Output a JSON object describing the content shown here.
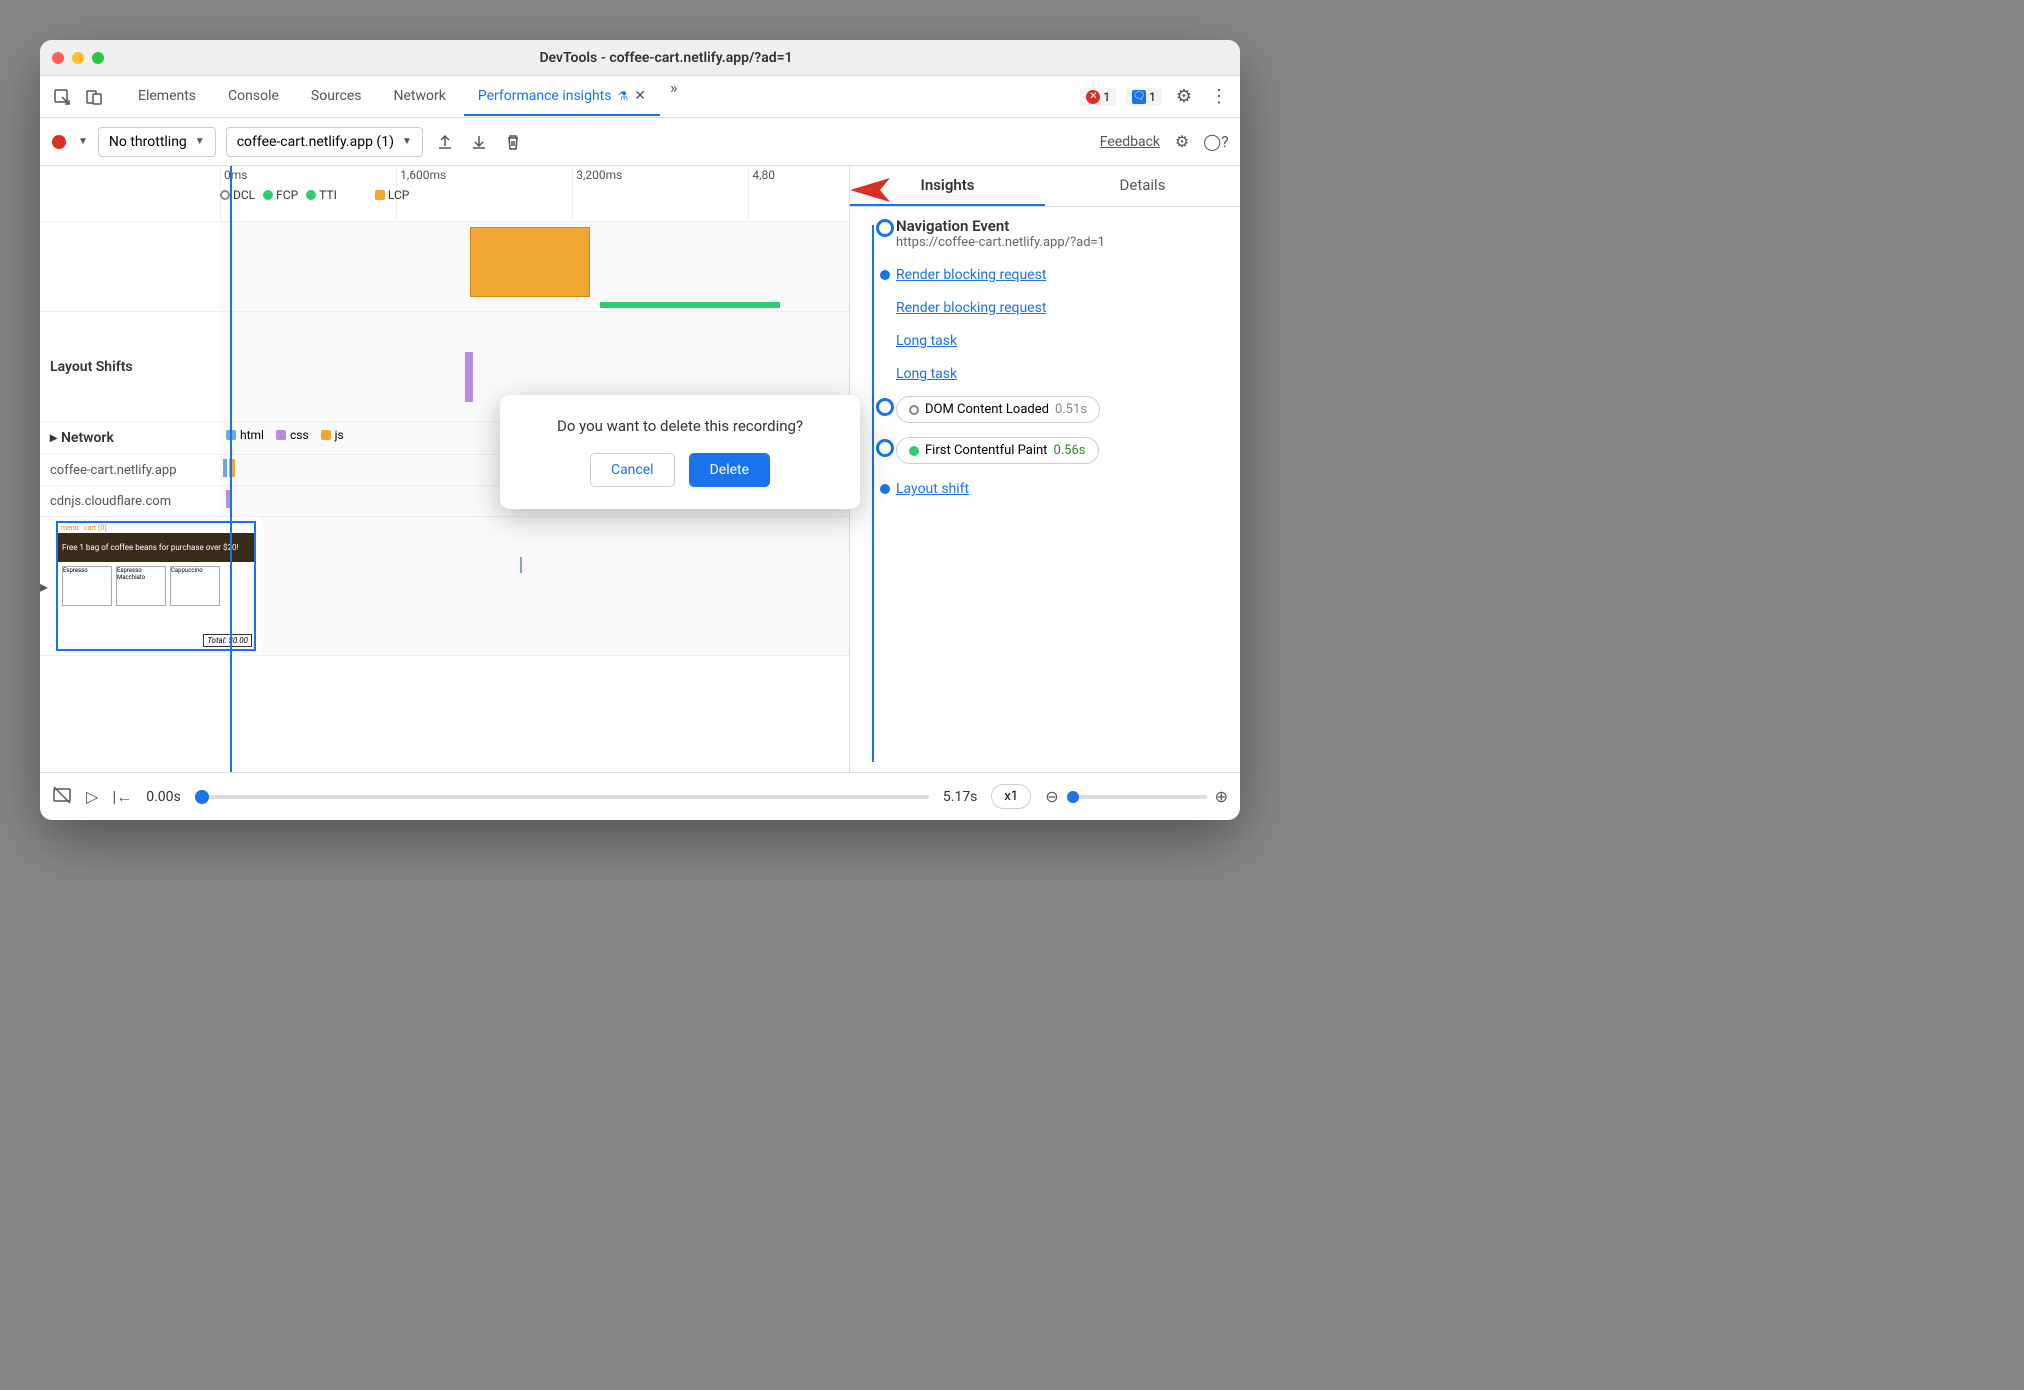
{
  "window_title": "DevTools - coffee-cart.netlify.app/?ad=1",
  "tabs": {
    "items": [
      "Elements",
      "Console",
      "Sources",
      "Network",
      "Performance insights"
    ],
    "active_index": 4,
    "overflow": "»"
  },
  "status": {
    "errors": "1",
    "info": "1"
  },
  "toolbar": {
    "throttling": "No throttling",
    "recording": "coffee-cart.netlify.app (1)",
    "feedback": "Feedback"
  },
  "timeline": {
    "ticks": [
      "0ms",
      "1,600ms",
      "3,200ms",
      "4,80"
    ],
    "markers": {
      "dcl": "DCL",
      "fcp": "FCP",
      "tti": "TTI",
      "lcp": "LCP"
    },
    "sections": {
      "layout_shifts": "Layout Shifts",
      "network": "Network",
      "legend": {
        "html": "html",
        "css": "css",
        "js": "js"
      },
      "hosts": [
        "coffee-cart.netlify.app",
        "cdnjs.cloudflare.com"
      ]
    }
  },
  "thumb": {
    "banner": "Free 1 bag of coffee beans for purchase over $20!",
    "items": [
      "Espresso",
      "Espresso Macchiato",
      "Cappuccino"
    ],
    "total": "Total: $0.00"
  },
  "bottombar": {
    "start": "0.00s",
    "end": "5.17s",
    "speed": "x1"
  },
  "right": {
    "tabs": {
      "insights": "Insights",
      "details": "Details"
    },
    "nav": {
      "title": "Navigation Event",
      "url": "https://coffee-cart.netlify.app/?ad=1"
    },
    "links": {
      "rbr1": "Render blocking request",
      "rbr2": "Render blocking request",
      "lt1": "Long task",
      "lt2": "Long task",
      "ls": "Layout shift"
    },
    "metrics": {
      "dcl_label": "DOM Content Loaded",
      "dcl_time": "0.51s",
      "fcp_label": "First Contentful Paint",
      "fcp_time": "0.56s"
    }
  },
  "dialog": {
    "message": "Do you want to delete this recording?",
    "cancel": "Cancel",
    "delete": "Delete"
  }
}
